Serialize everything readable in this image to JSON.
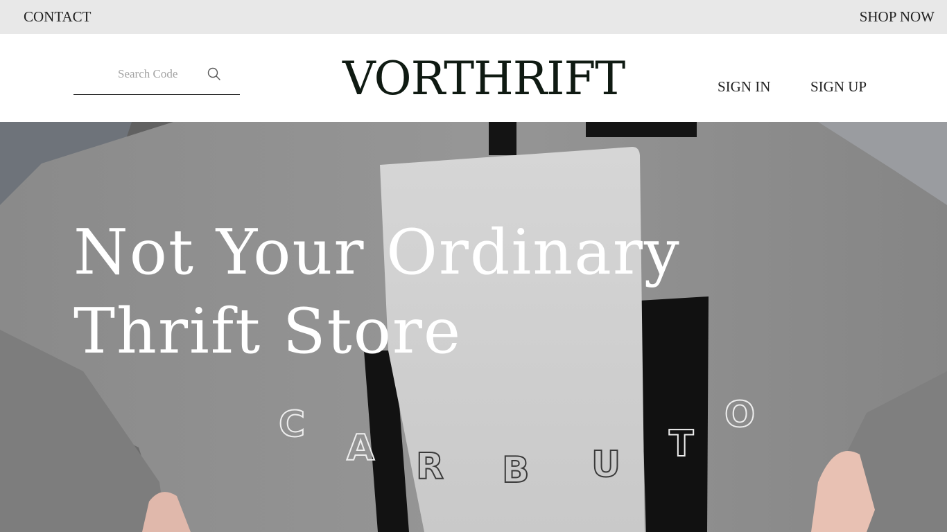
{
  "topbar": {
    "contact_label": "CONTACT",
    "shop_label": "SHOP NOW"
  },
  "header": {
    "search": {
      "placeholder": "Search Code",
      "icon": "search-icon"
    },
    "logo_text": "VORTHRIFT",
    "sign_in_label": "SIGN IN",
    "sign_up_label": "SIGN UP"
  },
  "hero": {
    "headline_line1": "Not Your Ordinary",
    "headline_line2": "Thrift Store",
    "shirt_print_text": "CARBUTO"
  },
  "colors": {
    "topbar_bg": "#e8e8e8",
    "logo": "#0f1a12",
    "hero_text": "#ffffff"
  }
}
